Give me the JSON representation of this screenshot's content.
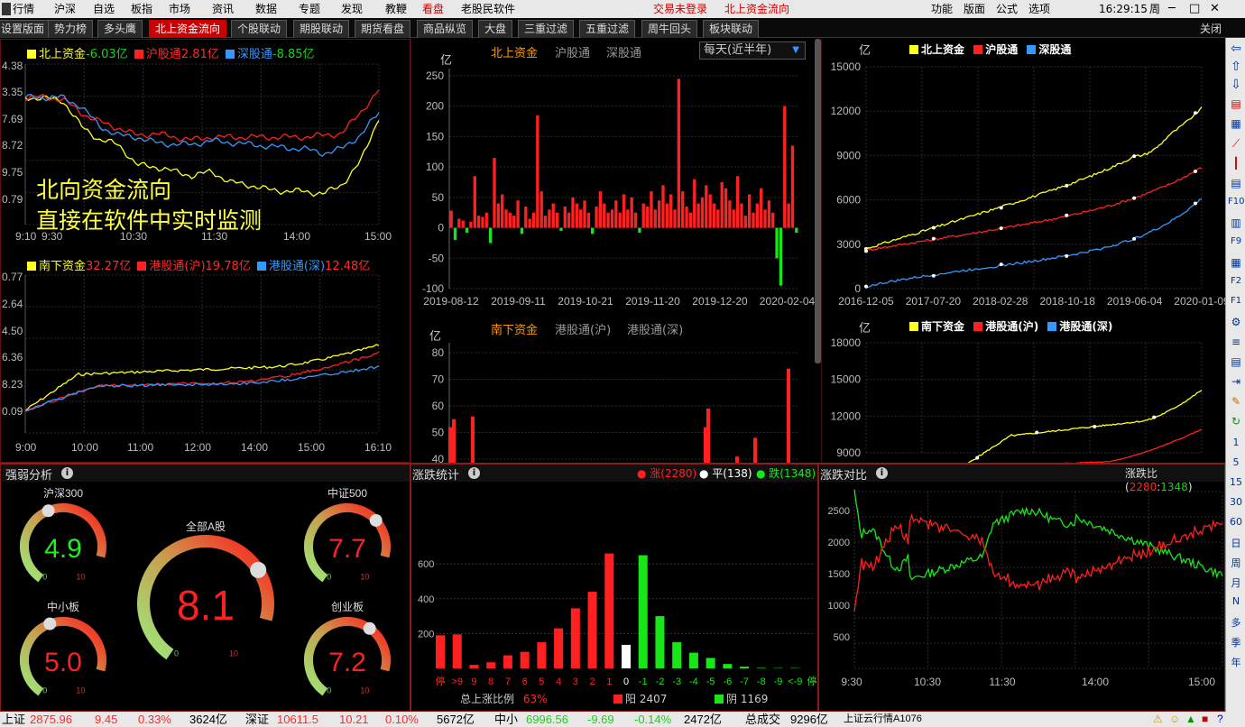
{
  "menu": {
    "left": [
      "行情",
      "沪深",
      "自选",
      "板指",
      "市场",
      "资讯",
      "数据",
      "专题",
      "发现",
      "教鞭",
      "看盘",
      "老股民软件"
    ],
    "active": "看盘",
    "notice1": "交易未登录",
    "notice2": "北上资金流向",
    "right": [
      "功能",
      "版面",
      "公式",
      "选项"
    ],
    "time": "16:29:15",
    "weekday": "周",
    "close": "关闭"
  },
  "tabs": [
    "设置版面",
    "势力榜",
    "多头鹰",
    "北上资金流向",
    "个股联动",
    "期股联动",
    "期货看盘",
    "商品纵览",
    "大盘",
    "三重过滤",
    "五重过滤",
    "周牛回头",
    "板块联动"
  ],
  "active_tab": "北上资金流向",
  "colors": {
    "north": "#ffff22",
    "sh": "#ff2020",
    "sz": "#3399ff",
    "up": "#ff2020",
    "down": "#19e619",
    "flat": "#ffffff"
  },
  "intraday_north": {
    "legend": [
      {
        "name": "北上资金",
        "value": "-6.03亿",
        "color": "yellow",
        "vcolor": "green"
      },
      {
        "name": "沪股通",
        "value": "2.81亿",
        "color": "red",
        "vcolor": "red"
      },
      {
        "name": "深股通",
        "value": "-8.85亿",
        "color": "blue",
        "vcolor": "green"
      }
    ],
    "y_labels": [
      "4.38",
      "3.35",
      "7.69",
      "8.72",
      "9.75",
      "0.79"
    ],
    "x_labels": [
      "9:10",
      "9:30",
      "10:30",
      "11:30",
      "14:00",
      "15:00"
    ],
    "overlay1": "北向资金流向",
    "overlay2": "直接在软件中实时监测",
    "series_y": [
      [
        108,
        109,
        111,
        140,
        155,
        160,
        183,
        185,
        190,
        195,
        190,
        202,
        205,
        210,
        212,
        212,
        215,
        205,
        180,
        130
      ],
      [
        108,
        108,
        110,
        125,
        135,
        142,
        150,
        148,
        152,
        155,
        152,
        152,
        152,
        152,
        152,
        152,
        150,
        148,
        125,
        100
      ],
      [
        108,
        108,
        108,
        118,
        140,
        150,
        152,
        158,
        160,
        160,
        156,
        158,
        160,
        162,
        164,
        165,
        170,
        165,
        150,
        125
      ]
    ]
  },
  "intraday_south": {
    "legend": [
      {
        "name": "南下资金",
        "value": "32.27亿",
        "color": "yellow",
        "vcolor": "red"
      },
      {
        "name": "港股通(沪)",
        "value": "19.78亿",
        "color": "red",
        "vcolor": "red"
      },
      {
        "name": "港股通(深)",
        "value": "12.48亿",
        "color": "blue",
        "vcolor": "red"
      }
    ],
    "y_labels": [
      "0.77",
      "2.64",
      "4.50",
      "6.36",
      "8.23",
      "0.09"
    ],
    "x_labels": [
      "9:00",
      "10:00",
      "11:00",
      "12:00",
      "14:00",
      "15:00",
      "16:10"
    ]
  },
  "daily_north": {
    "tabs": [
      "北上资金",
      "沪股通",
      "深股通"
    ],
    "unit": "亿",
    "dropdown": "每天(近半年)",
    "y_labels": [
      "250",
      "200",
      "150",
      "100",
      "50",
      "0",
      "-50",
      "-100"
    ],
    "x_labels": [
      "2019-08-12",
      "2019-09-11",
      "2019-10-21",
      "2019-11-20",
      "2019-12-20",
      "2020-02-04"
    ],
    "values": [
      28,
      -20,
      15,
      12,
      -8,
      10,
      85,
      20,
      18,
      25,
      -25,
      115,
      40,
      55,
      30,
      25,
      20,
      45,
      -10,
      35,
      15,
      25,
      185,
      60,
      20,
      30,
      40,
      25,
      -5,
      35,
      25,
      50,
      40,
      30,
      45,
      25,
      -10,
      35,
      60,
      40,
      25,
      30,
      45,
      25,
      55,
      30,
      50,
      25,
      -8,
      40,
      35,
      60,
      30,
      45,
      70,
      40,
      55,
      30,
      245,
      60,
      35,
      25,
      80,
      40,
      50,
      70,
      55,
      40,
      30,
      75,
      65,
      45,
      30,
      85,
      40,
      20,
      55,
      25,
      40,
      65,
      30,
      45,
      25,
      -50,
      -95,
      200,
      40,
      135,
      -8
    ]
  },
  "daily_south": {
    "tabs": [
      "南下资金",
      "港股通(沪)",
      "港股通(深)"
    ],
    "unit": "亿",
    "y_labels": [
      "80",
      "70",
      "60",
      "50",
      "40"
    ],
    "bars": [
      [
        497,
        52
      ],
      [
        501,
        55
      ],
      [
        522,
        56
      ],
      [
        780,
        52
      ],
      [
        783,
        59
      ],
      [
        815,
        41
      ],
      [
        835,
        48
      ],
      [
        872,
        74
      ]
    ]
  },
  "cum_north": {
    "unit": "亿",
    "legend": [
      "北上资金",
      "沪股通",
      "深股通"
    ],
    "y_labels": [
      "15000",
      "12000",
      "9000",
      "6000",
      "3000",
      "0"
    ],
    "x_labels": [
      "2016-12-05",
      "2017-07-20",
      "2018-02-28",
      "2018-10-18",
      "2019-06-04",
      "2020-01-09"
    ]
  },
  "cum_south": {
    "unit": "亿",
    "legend": [
      "南下资金",
      "港股通(沪)",
      "港股通(深)"
    ],
    "y_labels": [
      "18000",
      "15000",
      "12000",
      "9000"
    ]
  },
  "strength": {
    "title": "强弱分析",
    "gauges": [
      {
        "name": "沪深300",
        "value": "4.9",
        "level": 0.49,
        "vcolor": "green",
        "min": "0",
        "max": "10"
      },
      {
        "name": "中证500",
        "value": "7.7",
        "level": 0.77,
        "vcolor": "red",
        "min": "0",
        "max": "10"
      },
      {
        "name": "全部A股",
        "value": "8.1",
        "level": 0.81,
        "vcolor": "red",
        "min": "0",
        "max": "10"
      },
      {
        "name": "中小板",
        "value": "5.0",
        "level": 0.5,
        "vcolor": "red",
        "min": "0",
        "max": "10"
      },
      {
        "name": "创业板",
        "value": "7.2",
        "level": 0.72,
        "vcolor": "red",
        "min": "0",
        "max": "10"
      }
    ]
  },
  "updown": {
    "title": "涨跌统计",
    "legend_up": "涨(2280)",
    "legend_flat": "平(138)",
    "legend_down": "跌(1348)",
    "y_labels": [
      "600",
      "400",
      "200"
    ],
    "categories": [
      "停",
      ">9",
      "9",
      "8",
      "7",
      "6",
      "5",
      "4",
      "3",
      "2",
      "1",
      "0",
      "-1",
      "-2",
      "-3",
      "-4",
      "-5",
      "-6",
      "-7",
      "-8",
      "-9",
      "<-9",
      "停"
    ],
    "values": [
      190,
      195,
      20,
      35,
      75,
      95,
      150,
      230,
      345,
      440,
      660,
      135,
      650,
      300,
      150,
      90,
      60,
      25,
      10,
      3,
      2,
      2,
      0
    ],
    "types": [
      "up",
      "up",
      "up",
      "up",
      "up",
      "up",
      "up",
      "up",
      "up",
      "up",
      "up",
      "flat",
      "down",
      "down",
      "down",
      "down",
      "down",
      "down",
      "down",
      "down",
      "down",
      "down",
      "down"
    ],
    "ratio_label": "总上涨比例",
    "ratio_value": "63%",
    "yang_label": "阳",
    "yang_value": "2407",
    "yin_label": "阴",
    "yin_value": "1169"
  },
  "compare": {
    "title": "涨跌对比",
    "ratio_label": "涨跌比",
    "ratio_up": "2280",
    "ratio_down": "1348",
    "y_labels": [
      "2500",
      "2000",
      "1500",
      "1000",
      "500"
    ],
    "x_labels": [
      "9:30",
      "10:30",
      "11:30",
      "14:00",
      "15:00"
    ]
  },
  "status": {
    "sh_label": "上证",
    "sh_val": "2875.96",
    "sh_chg": "9.45",
    "sh_pct": "0.33%",
    "sh_amt": "3624亿",
    "sz_label": "深证",
    "sz_val": "10611.5",
    "sz_chg": "10.21",
    "sz_pct": "0.10%",
    "sz_amt": "5672亿",
    "zx_label": "中小",
    "zx_val": "6996.56",
    "zx_chg": "-9.69",
    "zx_pct": "-0.14%",
    "zx_amt": "2472亿",
    "total_label": "总成交",
    "total_val": "9296亿",
    "server": "上证云行情A1076"
  },
  "sidebar_numbers": [
    "1",
    "5",
    "15",
    "30",
    "60",
    "日",
    "周",
    "月",
    "N",
    "多",
    "季",
    "年"
  ]
}
